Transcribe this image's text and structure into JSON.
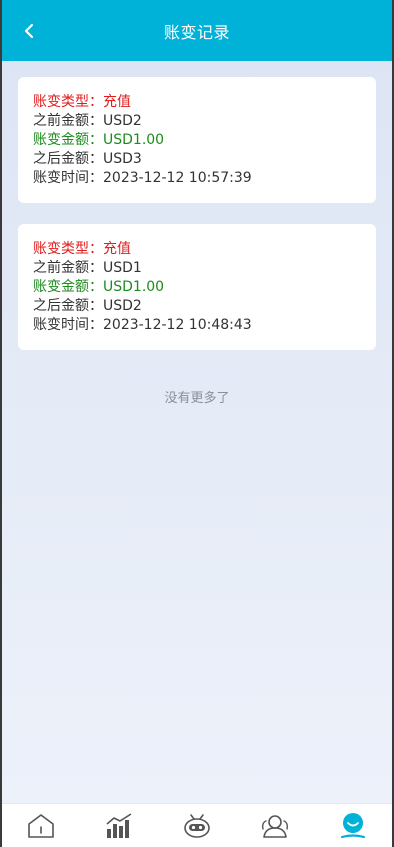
{
  "header": {
    "title": "账变记录"
  },
  "records": [
    {
      "type_label": "账变类型：",
      "type_value": "充值",
      "before_label": "之前金额：",
      "before_value": "USD2",
      "amount_label": "账变金额：",
      "amount_value": "USD1.00",
      "after_label": "之后金额：",
      "after_value": "USD3",
      "time_label": "账变时间：",
      "time_value": "2023-12-12 10:57:39"
    },
    {
      "type_label": "账变类型：",
      "type_value": "充值",
      "before_label": "之前金额：",
      "before_value": "USD1",
      "amount_label": "账变金额：",
      "amount_value": "USD1.00",
      "after_label": "之后金额：",
      "after_value": "USD2",
      "time_label": "账变时间：",
      "time_value": "2023-12-12 10:48:43"
    }
  ],
  "footer_note": "没有更多了",
  "tabbar": {
    "items": [
      {
        "icon": "home-icon",
        "active": false
      },
      {
        "icon": "market-chart-icon",
        "active": false
      },
      {
        "icon": "robot-icon",
        "active": false
      },
      {
        "icon": "team-icon",
        "active": false
      },
      {
        "icon": "profile-icon",
        "active": true
      }
    ],
    "active_color": "#00b1d8",
    "inactive_color": "#555555"
  },
  "colors": {
    "header_bg": "#00b1d8",
    "type_red": "#e21c1c",
    "amount_green": "#1d8a1d"
  }
}
